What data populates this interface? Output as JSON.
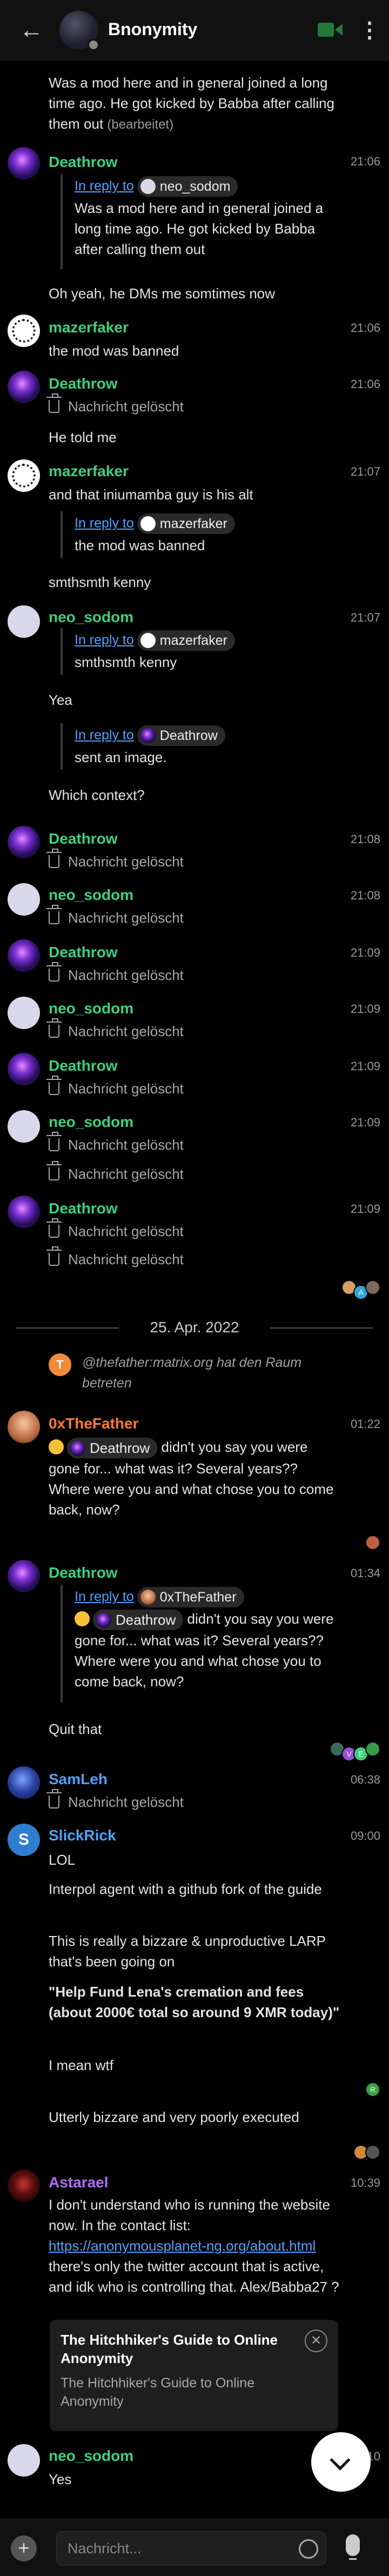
{
  "header": {
    "title": "Bnonymity",
    "back_icon": "arrow-left-icon",
    "video_icon": "video-call-icon",
    "menu_icon": "more-vert-icon"
  },
  "messages": {
    "m0": {
      "text": "Was a mod here and in general joined a long time ago. He got kicked by Babba after calling them out",
      "edited": "(bearbeitet)"
    },
    "m1": {
      "sender": "Deathrow",
      "time": "21:06",
      "reply_to": "In reply to",
      "reply_user": "neo_sodom",
      "reply_text": "Was a mod here and in general joined a long time ago. He got kicked by Babba after calling them out",
      "text": "Oh yeah, he DMs me somtimes now"
    },
    "m2": {
      "sender": "mazerfaker",
      "time": "21:06",
      "text": "the mod was banned"
    },
    "m3": {
      "sender": "Deathrow",
      "time": "21:06",
      "deleted": "Nachricht gelöscht",
      "text": "He told me"
    },
    "m4": {
      "sender": "mazerfaker",
      "time": "21:07",
      "text": "and that iniumamba guy is his alt",
      "reply_to": "In reply to",
      "reply_user": "mazerfaker",
      "reply_text": "the mod was banned",
      "text2": "smthsmth kenny"
    },
    "m5": {
      "sender": "neo_sodom",
      "time": "21:07",
      "reply_to": "In reply to",
      "reply_user": "mazerfaker",
      "reply_text": "smthsmth kenny",
      "text": "Yea",
      "reply_to2": "In reply to",
      "reply_user2": "Deathrow",
      "reply_text2": "sent an image.",
      "text2": "Which context?"
    },
    "m6": {
      "sender": "Deathrow",
      "time": "21:08",
      "deleted": "Nachricht gelöscht"
    },
    "m7": {
      "sender": "neo_sodom",
      "time": "21:08",
      "deleted": "Nachricht gelöscht"
    },
    "m8": {
      "sender": "Deathrow",
      "time": "21:09",
      "deleted": "Nachricht gelöscht"
    },
    "m9": {
      "sender": "neo_sodom",
      "time": "21:09",
      "deleted": "Nachricht gelöscht"
    },
    "m10": {
      "sender": "Deathrow",
      "time": "21:09",
      "deleted": "Nachricht gelöscht"
    },
    "m11": {
      "sender": "neo_sodom",
      "time": "21:09",
      "deleted": "Nachricht gelöscht",
      "deleted2": "Nachricht gelöscht"
    },
    "m12": {
      "sender": "Deathrow",
      "time": "21:09",
      "deleted": "Nachricht gelöscht",
      "deleted2": "Nachricht gelöscht"
    },
    "date_separator": "25. Apr. 2022",
    "m13": {
      "avatar_letter": "T",
      "text": "@thefather:matrix.org hat den Raum betreten"
    },
    "m14": {
      "sender": "0xTheFather",
      "time": "01:22",
      "mention": "Deathrow",
      "text": "didn't you say you were gone for... what was it? Several years?? Where were you and what chose you to come back, now?"
    },
    "m15": {
      "sender": "Deathrow",
      "time": "01:34",
      "reply_to": "In reply to",
      "reply_user": "0xTheFather",
      "reply_mention": "Deathrow",
      "reply_text": "didn't you say you were gone for... what was it? Several years?? Where were you and what chose you to come back, now?",
      "text": "Quit that"
    },
    "m16": {
      "sender": "SamLeh",
      "time": "06:38",
      "deleted": "Nachricht gelöscht"
    },
    "m17": {
      "sender": "SlickRick",
      "avatar_letter": "S",
      "time": "09:00",
      "lines": [
        "LOL",
        "Interpol agent with a github fork of the guide",
        "This is really a bizzare & unproductive LARP that's been going on",
        "\"Help Fund Lena's cremation and fees (about 2000€ total so around 9 XMR today)\"",
        "I mean wtf",
        "Utterly bizzare and very poorly executed"
      ]
    },
    "m18": {
      "sender": "Astarael",
      "time": "10:39",
      "text_a": "I don't understand who is running the website now. In the contact list: ",
      "link": "https://anonymousplanet-ng.org/about.html",
      "text_b": "there's only the twitter account that is active, and idk who is controlling that. Alex/Babba27 ?",
      "preview_title": "The Hitchhiker's Guide to Online Anonymity",
      "preview_desc": "The Hitchhiker's Guide to Online Anonymity"
    },
    "m19": {
      "sender": "neo_sodom",
      "time": "10",
      "text": "Yes"
    }
  },
  "reactions": {
    "r1": {
      "colors": [
        "#d9a066",
        "#2fa7d8",
        "#7a6a60"
      ],
      "letters": [
        "",
        "A",
        ""
      ]
    },
    "r2": {
      "colors": [
        "#c06040"
      ]
    },
    "r3": {
      "colors": [
        "#3a6a5a",
        "#9b4dd6",
        "#3bd17f",
        "#3a9a4a"
      ],
      "letters": [
        "",
        "V",
        "E",
        ""
      ]
    },
    "r4": {
      "colors": [
        "#3aa045"
      ],
      "letters": [
        "R"
      ]
    },
    "r5": {
      "colors": [
        "#d08a3a",
        "#555"
      ]
    }
  },
  "composer": {
    "placeholder": "Nachricht...",
    "plus_icon": "plus-icon",
    "emoji_icon": "emoji-icon",
    "mic_icon": "microphone-icon"
  },
  "scroll_button": {
    "icon": "chevron-down-icon"
  },
  "colors": {
    "background": "#000000",
    "accent_green": "#3bd17f",
    "accent_blue": "#4ea3ff",
    "accent_orange": "#ff7a2e",
    "accent_purple": "#b06bff"
  }
}
